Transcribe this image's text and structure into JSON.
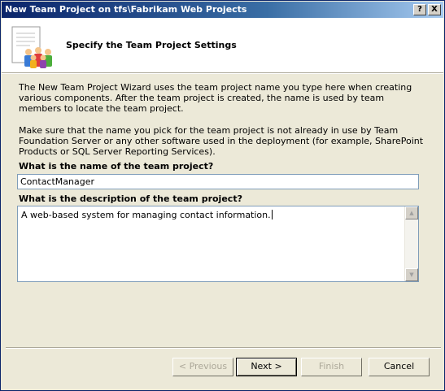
{
  "window": {
    "title": "New Team Project on tfs\\Fabrikam Web Projects",
    "help_label": "?",
    "close_label": "X"
  },
  "header": {
    "title": "Specify the Team Project Settings",
    "icon": "team-people-icon"
  },
  "body": {
    "paragraph1": "The New Team Project Wizard uses the team project name you type here when creating various components. After the team project is created, the name is used by team members to locate the team project.",
    "paragraph2": "Make sure that the name you pick for the team project is not already in use by Team Foundation Server or any other software used in the deployment (for example, SharePoint Products or SQL Server Reporting Services).",
    "name_label": "What is the name of the team project?",
    "name_value": "ContactManager",
    "description_label": "What is the description of the team project?",
    "description_value": "A web-based system for managing contact information."
  },
  "buttons": {
    "previous": "< Previous",
    "next": "Next >",
    "finish": "Finish",
    "cancel": "Cancel"
  },
  "colors": {
    "titlebar_start": "#0a246a",
    "dialog_bg": "#ece9d8",
    "input_border": "#7f9db9",
    "disabled_text": "#aca899"
  }
}
